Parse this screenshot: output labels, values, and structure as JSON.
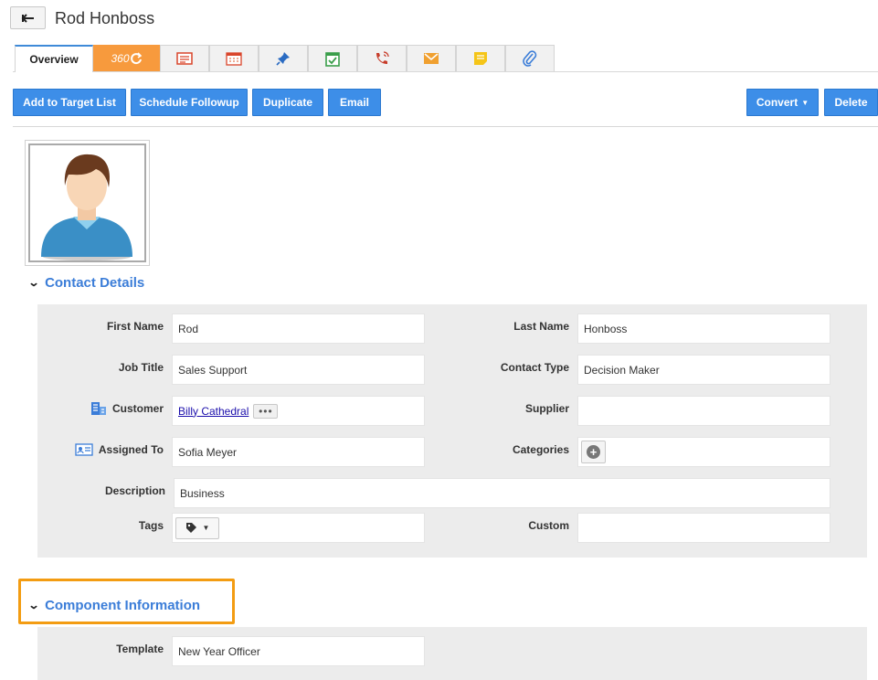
{
  "header": {
    "title": "Rod Honboss"
  },
  "tabs": {
    "overview": "Overview",
    "t360": "360",
    "icons": [
      "report-icon",
      "calendar-icon",
      "pin-icon",
      "task-icon",
      "call-icon",
      "mail-icon",
      "note-icon",
      "attachment-icon"
    ]
  },
  "actions": {
    "add_target": "Add to Target List",
    "schedule": "Schedule Followup",
    "duplicate": "Duplicate",
    "email": "Email",
    "convert": "Convert",
    "delete": "Delete"
  },
  "contact_details": {
    "heading": "Contact Details",
    "first_name_label": "First Name",
    "first_name": "Rod",
    "last_name_label": "Last Name",
    "last_name": "Honboss",
    "job_title_label": "Job Title",
    "job_title": "Sales Support",
    "contact_type_label": "Contact Type",
    "contact_type": "Decision Maker",
    "customer_label": "Customer",
    "customer": "Billy Cathedral",
    "supplier_label": "Supplier",
    "supplier": "",
    "assigned_label": "Assigned To",
    "assigned": "Sofia Meyer",
    "categories_label": "Categories",
    "description_label": "Description",
    "description": "Business",
    "tags_label": "Tags",
    "custom_label": "Custom",
    "custom": ""
  },
  "component_info": {
    "heading": "Component Information",
    "template_label": "Template",
    "template": "New Year Officer"
  },
  "colors": {
    "accent": "#3d8ee8",
    "orange": "#f79a3d",
    "highlight": "#f39c12"
  }
}
